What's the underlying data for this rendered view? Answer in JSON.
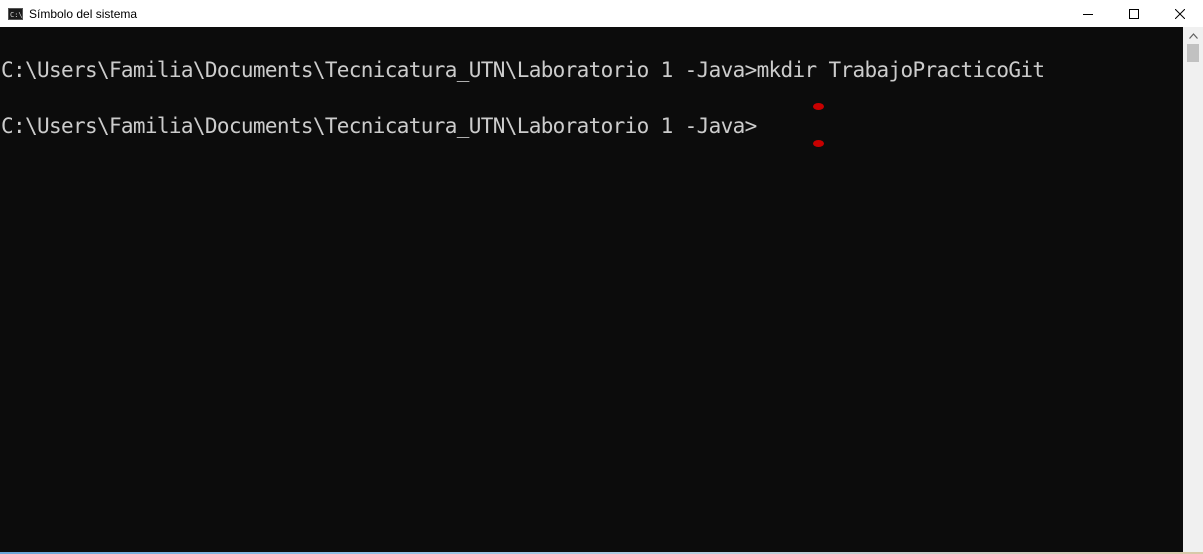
{
  "window": {
    "title": "Símbolo del sistema",
    "icon": "cmd-icon",
    "icon_text": "C:\\",
    "controls": [
      "minimize-icon",
      "maximize-icon",
      "close-icon"
    ]
  },
  "console": {
    "lines": [
      "C:\\Users\\Familia\\Documents\\Tecnicatura_UTN\\Laboratorio 1 -Java>mkdir TrabajoPracticoGit",
      "C:\\Users\\Familia\\Documents\\Tecnicatura_UTN\\Laboratorio 1 -Java>"
    ],
    "text_color": "#cccccc",
    "background": "#0c0c0c"
  },
  "colors": {
    "cursor_marker": "#c80000",
    "titlebar": "#ffffff"
  }
}
